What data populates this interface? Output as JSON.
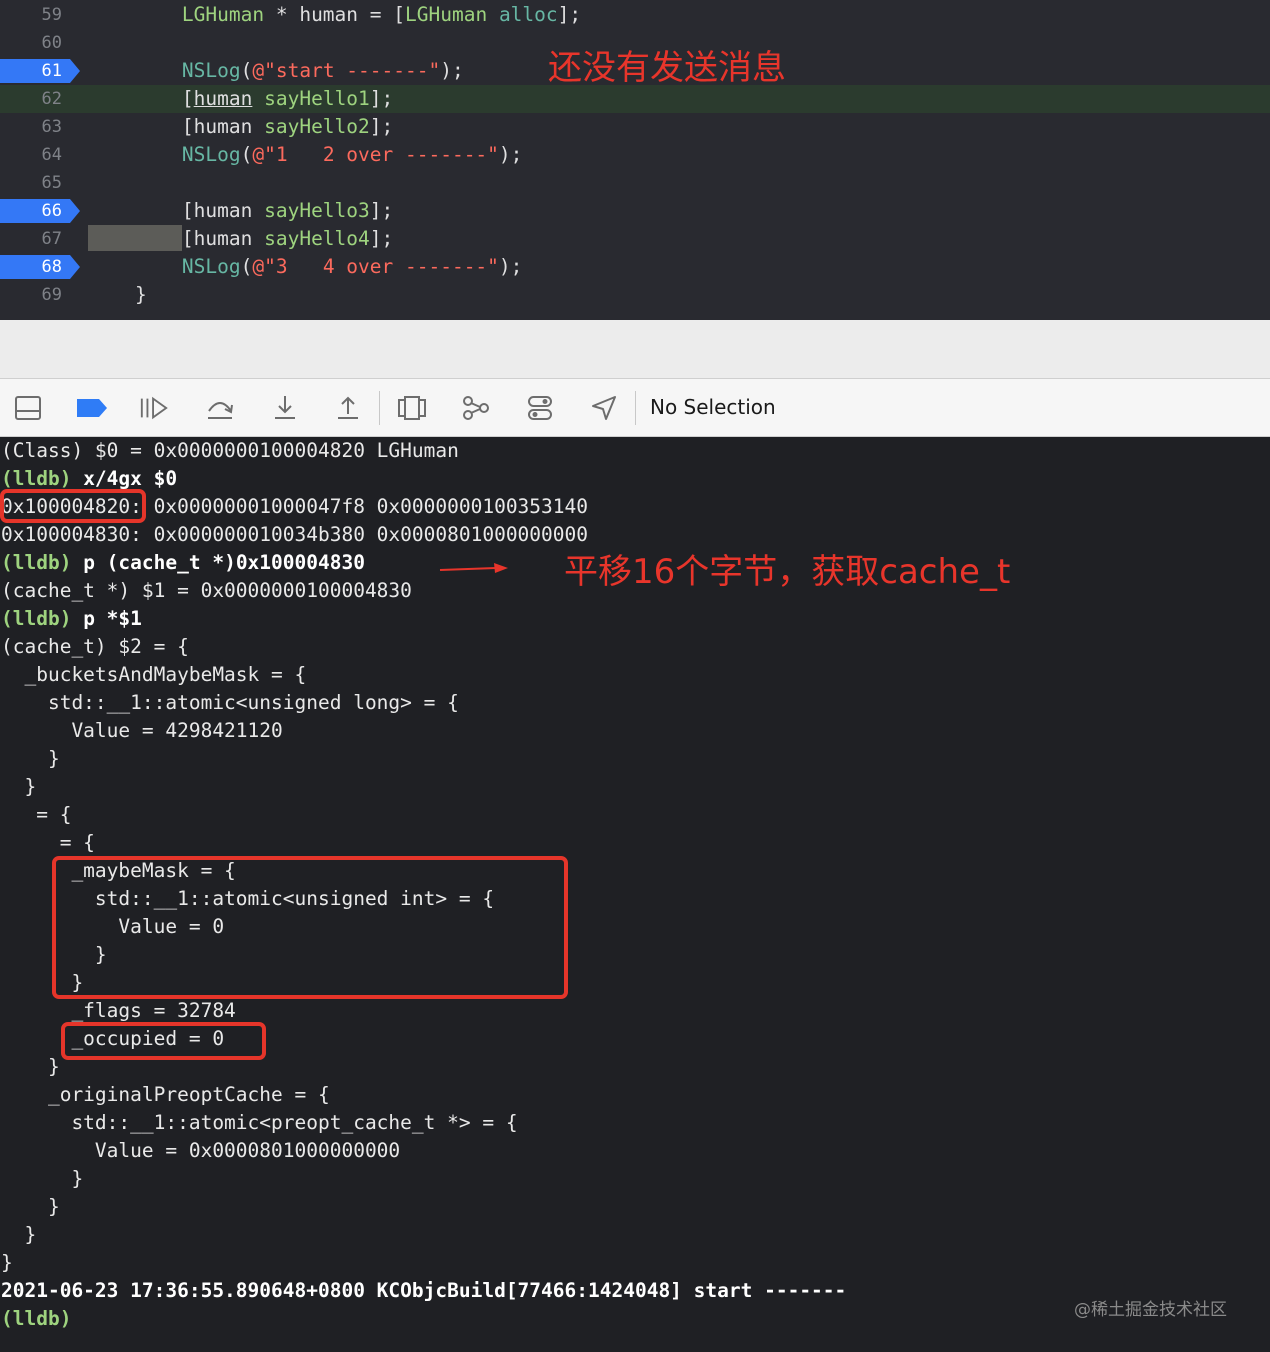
{
  "editor": {
    "lines": [
      {
        "num": "59",
        "breakpoint": false,
        "current": false,
        "tokens": [
          {
            "t": "        ",
            "c": "pln"
          },
          {
            "t": "LGHuman",
            "c": "cls"
          },
          {
            "t": " * human = [",
            "c": "pln"
          },
          {
            "t": "LGHuman",
            "c": "cls"
          },
          {
            "t": " ",
            "c": "pln"
          },
          {
            "t": "alloc",
            "c": "fn"
          },
          {
            "t": "];",
            "c": "pln"
          }
        ]
      },
      {
        "num": "60",
        "breakpoint": false,
        "current": false,
        "tokens": []
      },
      {
        "num": "61",
        "breakpoint": true,
        "current": false,
        "tokens": [
          {
            "t": "        ",
            "c": "pln"
          },
          {
            "t": "NSLog",
            "c": "fn"
          },
          {
            "t": "(",
            "c": "pln"
          },
          {
            "t": "@\"start -------\"",
            "c": "str"
          },
          {
            "t": ");",
            "c": "pln"
          }
        ]
      },
      {
        "num": "62",
        "breakpoint": false,
        "current": true,
        "tokens": [
          {
            "t": "        [",
            "c": "pln"
          },
          {
            "t": "human",
            "c": "pln",
            "u": true
          },
          {
            "t": " ",
            "c": "pln"
          },
          {
            "t": "sayHello1",
            "c": "cls"
          },
          {
            "t": "];",
            "c": "pln"
          }
        ]
      },
      {
        "num": "63",
        "breakpoint": false,
        "current": false,
        "tokens": [
          {
            "t": "        [human ",
            "c": "pln"
          },
          {
            "t": "sayHello2",
            "c": "cls"
          },
          {
            "t": "];",
            "c": "pln"
          }
        ]
      },
      {
        "num": "64",
        "breakpoint": false,
        "current": false,
        "tokens": [
          {
            "t": "        ",
            "c": "pln"
          },
          {
            "t": "NSLog",
            "c": "fn"
          },
          {
            "t": "(",
            "c": "pln"
          },
          {
            "t": "@\"1   2 over -------\"",
            "c": "str"
          },
          {
            "t": ");",
            "c": "pln"
          }
        ]
      },
      {
        "num": "65",
        "breakpoint": false,
        "current": false,
        "tokens": []
      },
      {
        "num": "66",
        "breakpoint": true,
        "current": false,
        "tokens": [
          {
            "t": "        [human ",
            "c": "pln"
          },
          {
            "t": "sayHello3",
            "c": "cls"
          },
          {
            "t": "];",
            "c": "pln"
          }
        ]
      },
      {
        "num": "67",
        "breakpoint": false,
        "current": false,
        "tokens": [
          {
            "t": "        ",
            "c": "box"
          },
          {
            "t": "[human ",
            "c": "pln"
          },
          {
            "t": "sayHello4",
            "c": "cls"
          },
          {
            "t": "];",
            "c": "pln"
          }
        ]
      },
      {
        "num": "68",
        "breakpoint": true,
        "current": false,
        "tokens": [
          {
            "t": "        ",
            "c": "pln"
          },
          {
            "t": "NSLog",
            "c": "fn"
          },
          {
            "t": "(",
            "c": "pln"
          },
          {
            "t": "@\"3   4 over -------\"",
            "c": "str"
          },
          {
            "t": ");",
            "c": "pln"
          }
        ]
      },
      {
        "num": "69",
        "breakpoint": false,
        "current": false,
        "tokens": [
          {
            "t": "    }",
            "c": "pln"
          }
        ]
      }
    ],
    "annotation": "还没有发送消息"
  },
  "debug_bar": {
    "icons": [
      "console-toggle-icon",
      "breakpoint-toggle-icon",
      "continue-icon",
      "step-over-icon",
      "step-into-icon",
      "step-out-icon",
      "view-hierarchy-icon",
      "memory-graph-icon",
      "environment-overrides-icon",
      "location-icon"
    ],
    "selection_label": "No Selection"
  },
  "console": {
    "lines": [
      {
        "prompt": "",
        "text": "(Class) $0 = 0x0000000100004820 LGHuman",
        "style": "out"
      },
      {
        "prompt": "(lldb)",
        "text": " x/4gx $0",
        "style": "cmd"
      },
      {
        "prompt": "",
        "text": "0x100004820: 0x00000001000047f8 0x0000000100353140",
        "style": "out"
      },
      {
        "prompt": "",
        "text": "0x100004830: 0x000000010034b380 0x0000801000000000",
        "style": "out"
      },
      {
        "prompt": "(lldb)",
        "text": " p (cache_t *)0x100004830",
        "style": "cmd"
      },
      {
        "prompt": "",
        "text": "(cache_t *) $1 = 0x0000000100004830",
        "style": "out"
      },
      {
        "prompt": "(lldb)",
        "text": " p *$1",
        "style": "cmd"
      },
      {
        "prompt": "",
        "text": "(cache_t) $2 = {",
        "style": "out"
      },
      {
        "prompt": "",
        "text": "  _bucketsAndMaybeMask = {",
        "style": "out"
      },
      {
        "prompt": "",
        "text": "    std::__1::atomic<unsigned long> = {",
        "style": "out"
      },
      {
        "prompt": "",
        "text": "      Value = 4298421120",
        "style": "out"
      },
      {
        "prompt": "",
        "text": "    }",
        "style": "out"
      },
      {
        "prompt": "",
        "text": "  }",
        "style": "out"
      },
      {
        "prompt": "",
        "text": "   = {",
        "style": "out"
      },
      {
        "prompt": "",
        "text": "     = {",
        "style": "out"
      },
      {
        "prompt": "",
        "text": "      _maybeMask = {",
        "style": "out"
      },
      {
        "prompt": "",
        "text": "        std::__1::atomic<unsigned int> = {",
        "style": "out"
      },
      {
        "prompt": "",
        "text": "          Value = 0",
        "style": "out"
      },
      {
        "prompt": "",
        "text": "        }",
        "style": "out"
      },
      {
        "prompt": "",
        "text": "      }",
        "style": "out"
      },
      {
        "prompt": "",
        "text": "      _flags = 32784",
        "style": "out"
      },
      {
        "prompt": "",
        "text": "      _occupied = 0",
        "style": "out"
      },
      {
        "prompt": "",
        "text": "    }",
        "style": "out"
      },
      {
        "prompt": "",
        "text": "    _originalPreoptCache = {",
        "style": "out"
      },
      {
        "prompt": "",
        "text": "      std::__1::atomic<preopt_cache_t *> = {",
        "style": "out"
      },
      {
        "prompt": "",
        "text": "        Value = 0x0000801000000000",
        "style": "out"
      },
      {
        "prompt": "",
        "text": "      }",
        "style": "out"
      },
      {
        "prompt": "",
        "text": "    }",
        "style": "out"
      },
      {
        "prompt": "",
        "text": "  }",
        "style": "out"
      },
      {
        "prompt": "",
        "text": "}",
        "style": "out"
      },
      {
        "prompt": "",
        "text": "2021-06-23 17:36:55.890648+0800 KCObjcBuild[77466:1424048] start -------",
        "style": "log"
      },
      {
        "prompt": "(lldb)",
        "text": "",
        "style": "cmd"
      }
    ],
    "annotation": "平移16个字节，获取cache_t",
    "watermark": "@稀土掘金技术社区"
  }
}
